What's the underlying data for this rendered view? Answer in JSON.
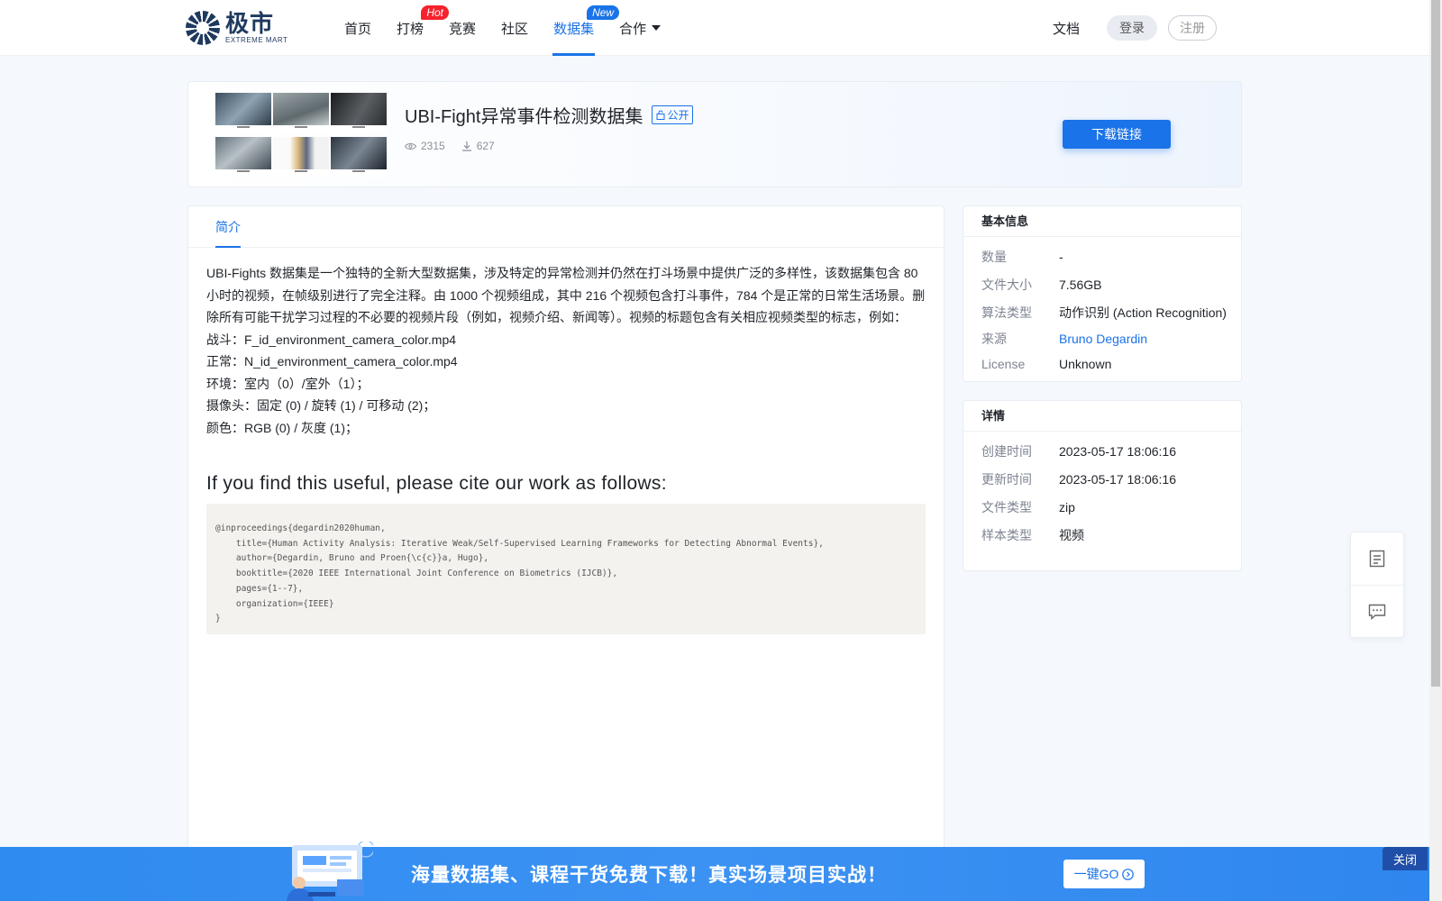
{
  "nav": {
    "logo_cn": "极市",
    "logo_en": "EXTREME MART",
    "items": [
      {
        "label": "首页"
      },
      {
        "label": "打榜",
        "badge": "Hot"
      },
      {
        "label": "竞赛"
      },
      {
        "label": "社区"
      },
      {
        "label": "数据集",
        "badge": "New"
      },
      {
        "label": "合作"
      }
    ],
    "docs": "文档",
    "login": "登录",
    "register": "注册"
  },
  "dataset": {
    "title": "UBI-Fight异常事件检测数据集",
    "visibility": "公开",
    "views": "2315",
    "downloads": "627",
    "download_button": "下载链接"
  },
  "tabs": [
    {
      "label": "简介"
    }
  ],
  "description": {
    "paragraphs": [
      "UBI-Fights 数据集是一个独特的全新大型数据集，涉及特定的异常检测并仍然在打斗场景中提供广泛的多样性，该数据集包含 80 小时的视频，在帧级别进行了完全注释。由 1000 个视频组成，其中 216 个视频包含打斗事件，784 个是正常的日常生活场景。删除所有可能干扰学习过程的不必要的视频片段（例如，视频介绍、新闻等）。视频的标题包含有关相应视频类型的标志，例如：",
      "战斗：F_id_environment_camera_color.mp4",
      "正常：N_id_environment_camera_color.mp4",
      "环境：室内（0）/室外（1）；",
      "摄像头：固定 (0) / 旋转 (1) / 可移动 (2)；",
      "颜色：RGB (0) / 灰度 (1)；"
    ],
    "cite_heading": "If you find this useful, please cite our work as follows:",
    "citation": "@inproceedings{degardin2020human,\n    title={Human Activity Analysis: Iterative Weak/Self-Supervised Learning Frameworks for Detecting Abnormal Events},\n    author={Degardin, Bruno and Proen{\\c{c}}a, Hugo},\n    booktitle={2020 IEEE International Joint Conference on Biometrics (IJCB)},\n    pages={1--7},\n    organization={IEEE}\n}"
  },
  "basic_info": {
    "title": "基本信息",
    "rows": [
      {
        "key": "数量",
        "value": "-"
      },
      {
        "key": "文件大小",
        "value": "7.56GB"
      },
      {
        "key": "算法类型",
        "value": "动作识别 (Action Recognition)"
      },
      {
        "key": "来源",
        "value": "Bruno Degardin"
      },
      {
        "key": "License",
        "value": "Unknown"
      }
    ]
  },
  "details": {
    "title": "详情",
    "rows": [
      {
        "key": "创建时间",
        "value": "2023-05-17 18:06:16"
      },
      {
        "key": "更新时间",
        "value": "2023-05-17 18:06:16"
      },
      {
        "key": "文件类型",
        "value": "zip"
      },
      {
        "key": "样本类型",
        "value": "视频"
      }
    ]
  },
  "banner": {
    "text": "海量数据集、课程干货免费下载！真实场景项目实战！",
    "go": "一键GO",
    "close": "关闭"
  },
  "colors": {
    "accent": "#1a73e8",
    "hot_badge": "#f5222d",
    "banner": "#3c92f3"
  },
  "icons": [
    "eye-icon",
    "download-icon",
    "document-icon",
    "message-icon",
    "arrow-circle-right-icon",
    "caret-down-icon",
    "lock-icon"
  ]
}
